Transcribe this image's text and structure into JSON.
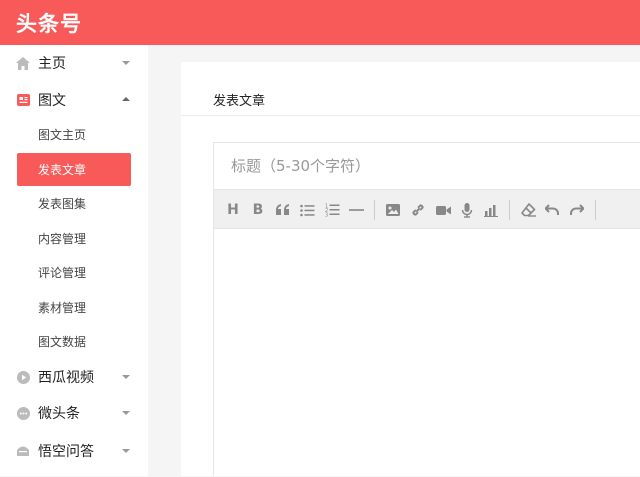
{
  "app": {
    "logo": "头条号"
  },
  "sidebar": {
    "groups": [
      {
        "label": "主页",
        "icon": "home-icon",
        "expanded": false
      },
      {
        "label": "图文",
        "icon": "article-icon",
        "expanded": true
      },
      {
        "label": "西瓜视频",
        "icon": "video-play-icon",
        "expanded": false
      },
      {
        "label": "微头条",
        "icon": "chat-bubble-icon",
        "expanded": false
      },
      {
        "label": "悟空问答",
        "icon": "qa-icon",
        "expanded": false
      }
    ],
    "sub_items": [
      {
        "label": "图文主页",
        "active": false
      },
      {
        "label": "发表文章",
        "active": true
      },
      {
        "label": "发表图集",
        "active": false
      },
      {
        "label": "内容管理",
        "active": false
      },
      {
        "label": "评论管理",
        "active": false
      },
      {
        "label": "素材管理",
        "active": false
      },
      {
        "label": "图文数据",
        "active": false
      }
    ]
  },
  "main": {
    "card_title": "发表文章",
    "title_placeholder": "标题（5-30个字符）",
    "title_value": "",
    "toolbar": [
      {
        "name": "heading-button",
        "icon": "heading-icon",
        "text": "H"
      },
      {
        "name": "bold-button",
        "icon": "bold-icon",
        "text": "B"
      },
      {
        "name": "quote-button",
        "icon": "quote-icon"
      },
      {
        "name": "bullet-list-button",
        "icon": "bullet-list-icon"
      },
      {
        "name": "ordered-list-button",
        "icon": "ordered-list-icon"
      },
      {
        "name": "divider-button",
        "icon": "horizontal-rule-icon"
      },
      {
        "name": "insert-image-button",
        "icon": "image-icon"
      },
      {
        "name": "insert-link-button",
        "icon": "link-icon"
      },
      {
        "name": "insert-video-button",
        "icon": "video-camera-icon"
      },
      {
        "name": "insert-audio-button",
        "icon": "microphone-icon"
      },
      {
        "name": "insert-chart-button",
        "icon": "bar-chart-icon"
      },
      {
        "name": "clear-format-button",
        "icon": "eraser-icon"
      },
      {
        "name": "undo-button",
        "icon": "undo-icon"
      },
      {
        "name": "redo-button",
        "icon": "redo-icon"
      }
    ]
  },
  "colors": {
    "brand": "#f85959",
    "sidebar_bg": "#ffffff",
    "page_bg": "#f5f5f5",
    "toolbar_bg": "#f0f0f0"
  }
}
